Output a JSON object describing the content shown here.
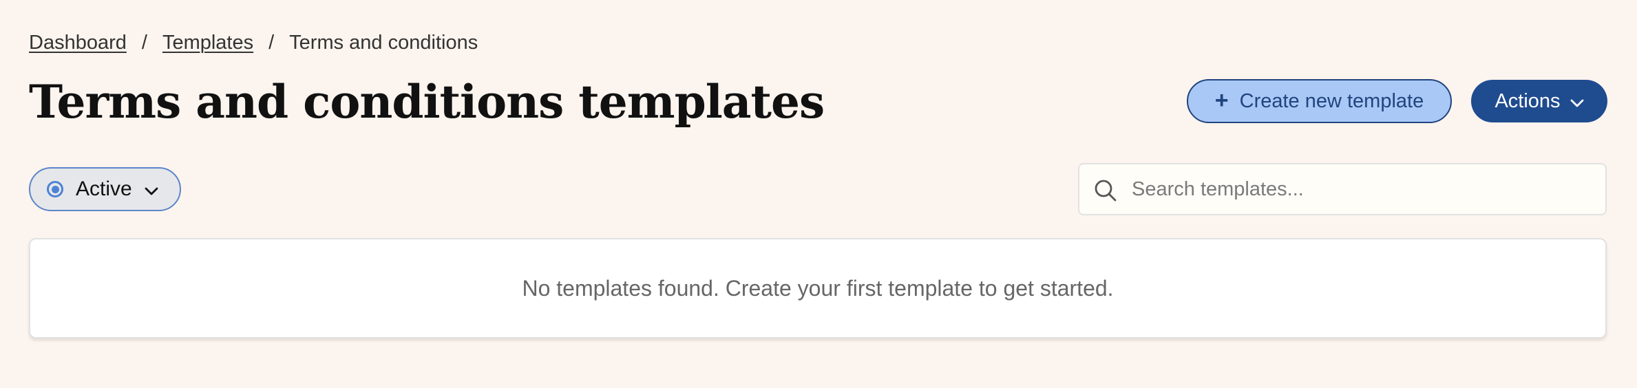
{
  "breadcrumb": {
    "items": [
      {
        "label": "Dashboard"
      },
      {
        "label": "Templates"
      },
      {
        "label": "Terms and conditions"
      }
    ],
    "separator": "/"
  },
  "page": {
    "title": "Terms and conditions templates"
  },
  "toolbar": {
    "create_icon": "plus-icon",
    "create_label": "Create new template",
    "actions_label": "Actions",
    "actions_icon": "chevron-down-icon"
  },
  "filter": {
    "status_icon": "radio-icon",
    "status_label": "Active",
    "dropdown_icon": "chevron-down-icon"
  },
  "search": {
    "icon": "search-icon",
    "placeholder": "Search templates...",
    "value": ""
  },
  "empty_state": {
    "message": "No templates found. Create your first template to get started."
  },
  "colors": {
    "background": "#fcf4ee",
    "primary": "#1f4b8f",
    "primary_light": "#a9c8f5",
    "accent": "#4d82d6"
  }
}
